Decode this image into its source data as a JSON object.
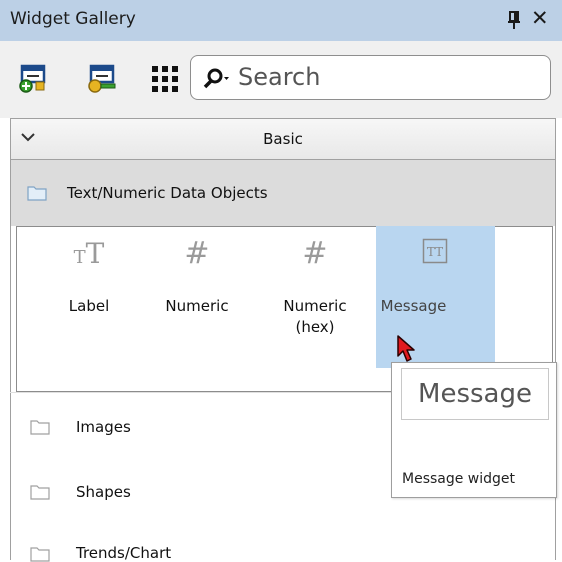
{
  "window": {
    "title": "Widget Gallery",
    "close_glyph": "✕"
  },
  "toolbar": {
    "icons": [
      "add-widget-icon",
      "edit-widget-icon",
      "grid-view-icon"
    ],
    "search_placeholder": "Search"
  },
  "group": {
    "label": "Basic",
    "expanded": true
  },
  "categories": {
    "text_numeric": "Text/Numeric Data Objects",
    "images": "Images",
    "shapes": "Shapes",
    "trends": "Trends/Chart"
  },
  "widgets": [
    {
      "icon_text": "TT",
      "label": "Label"
    },
    {
      "icon_text": "#",
      "label": "Numeric"
    },
    {
      "icon_text": "#",
      "label": "Numeric\n(hex)"
    },
    {
      "icon_text": "TT",
      "label": "Message",
      "selected": true
    }
  ],
  "tooltip": {
    "preview": "Message",
    "description": "Message widget"
  },
  "colors": {
    "titlebar": "#bcd0e6",
    "selection": "#b9d6f0",
    "cursor": "#e0191f"
  }
}
